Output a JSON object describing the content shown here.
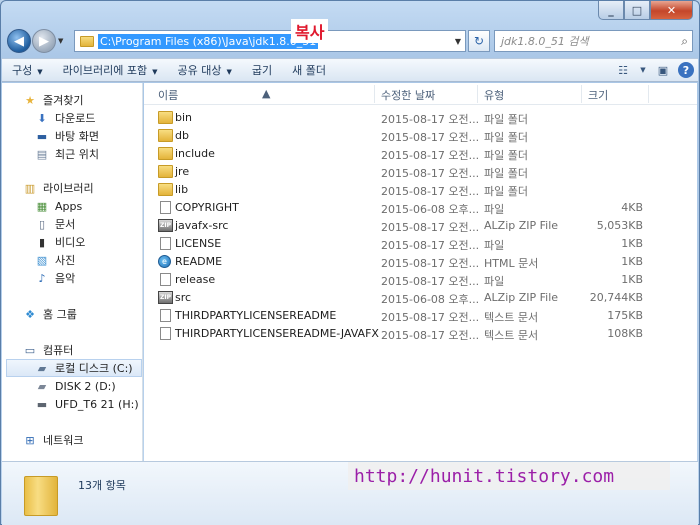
{
  "window": {
    "close_glyph": "✕",
    "max_glyph": "□",
    "min_glyph": "_"
  },
  "annotation": {
    "copy_label": "복사",
    "watermark": "http://hunit.tistory.com"
  },
  "address": {
    "path": "C:\\Program Files (x86)\\Java\\jdk1.8.0_51"
  },
  "search": {
    "placeholder": "jdk1.8.0_51 검색"
  },
  "toolbar": {
    "items": [
      {
        "label": "구성",
        "has_dropdown": true
      },
      {
        "label": "라이브러리에 포함",
        "has_dropdown": true
      },
      {
        "label": "공유 대상",
        "has_dropdown": true
      },
      {
        "label": "굽기",
        "has_dropdown": false
      },
      {
        "label": "새 폴더",
        "has_dropdown": false
      }
    ]
  },
  "nav": {
    "favorites": {
      "label": "즐겨찾기",
      "items": [
        "다운로드",
        "바탕 화면",
        "최근 위치"
      ]
    },
    "libraries": {
      "label": "라이브러리",
      "items": [
        "Apps",
        "문서",
        "비디오",
        "사진",
        "음악"
      ]
    },
    "homegroup": {
      "label": "홈 그룹"
    },
    "computer": {
      "label": "컴퓨터",
      "items": [
        "로컬 디스크 (C:)",
        "DISK 2 (D:)",
        "UFD_T6 21 (H:)"
      ],
      "selected": "로컬 디스크 (C:)"
    },
    "network": {
      "label": "네트워크"
    }
  },
  "columns": {
    "name": "이름",
    "date": "수정한 날짜",
    "type": "유형",
    "size": "크기"
  },
  "files": [
    {
      "name": "bin",
      "date": "2015-08-17 오전...",
      "type": "파일 폴더",
      "size": "",
      "icon": "folder"
    },
    {
      "name": "db",
      "date": "2015-08-17 오전...",
      "type": "파일 폴더",
      "size": "",
      "icon": "folder"
    },
    {
      "name": "include",
      "date": "2015-08-17 오전...",
      "type": "파일 폴더",
      "size": "",
      "icon": "folder"
    },
    {
      "name": "jre",
      "date": "2015-08-17 오전...",
      "type": "파일 폴더",
      "size": "",
      "icon": "folder"
    },
    {
      "name": "lib",
      "date": "2015-08-17 오전...",
      "type": "파일 폴더",
      "size": "",
      "icon": "folder"
    },
    {
      "name": "COPYRIGHT",
      "date": "2015-06-08 오후...",
      "type": "파일",
      "size": "4KB",
      "icon": "doc"
    },
    {
      "name": "javafx-src",
      "date": "2015-08-17 오전...",
      "type": "ALZip ZIP File",
      "size": "5,053KB",
      "icon": "zip"
    },
    {
      "name": "LICENSE",
      "date": "2015-08-17 오전...",
      "type": "파일",
      "size": "1KB",
      "icon": "doc"
    },
    {
      "name": "README",
      "date": "2015-08-17 오전...",
      "type": "HTML 문서",
      "size": "1KB",
      "icon": "html"
    },
    {
      "name": "release",
      "date": "2015-08-17 오전...",
      "type": "파일",
      "size": "1KB",
      "icon": "doc"
    },
    {
      "name": "src",
      "date": "2015-06-08 오후...",
      "type": "ALZip ZIP File",
      "size": "20,744KB",
      "icon": "zip"
    },
    {
      "name": "THIRDPARTYLICENSEREADME",
      "date": "2015-08-17 오전...",
      "type": "텍스트 문서",
      "size": "175KB",
      "icon": "doc"
    },
    {
      "name": "THIRDPARTYLICENSEREADME-JAVAFX",
      "date": "2015-08-17 오전...",
      "type": "텍스트 문서",
      "size": "108KB",
      "icon": "doc"
    }
  ],
  "status": {
    "item_count": "13개 항목"
  }
}
